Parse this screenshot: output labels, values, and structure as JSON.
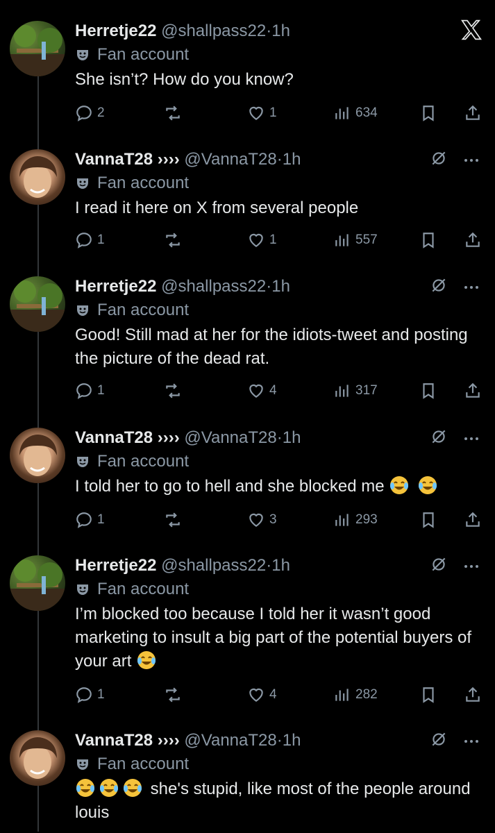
{
  "app": {
    "logo": "x-logo-icon"
  },
  "tweets": [
    {
      "name": "Herretje22",
      "handle": "@shallpass22",
      "dot": "·",
      "time": "1h",
      "label": "Fan account",
      "text": "She isn’t? How do you know?",
      "replies": "2",
      "likes": "1",
      "views": "634",
      "avatar": "green"
    },
    {
      "name": "VannaT28 ››››",
      "handle": "@VannaT28",
      "dot": "·",
      "time": "1h",
      "label": "Fan account",
      "text": "I read it here on X from several people",
      "replies": "1",
      "likes": "1",
      "views": "557",
      "avatar": "face"
    },
    {
      "name": "Herretje22",
      "handle": "@shallpass22",
      "dot": "·",
      "time": "1h",
      "label": "Fan account",
      "text": "Good! Still mad at her for the idiots-tweet and posting the picture of the dead rat.",
      "replies": "1",
      "likes": "4",
      "views": "317",
      "avatar": "green"
    },
    {
      "name": "VannaT28 ››››",
      "handle": "@VannaT28",
      "dot": "·",
      "time": "1h",
      "label": "Fan account",
      "text": "I told her to go to hell and she blocked me",
      "emoji_after": 2,
      "replies": "1",
      "likes": "3",
      "views": "293",
      "avatar": "face"
    },
    {
      "name": "Herretje22",
      "handle": "@shallpass22",
      "dot": "·",
      "time": "1h",
      "label": "Fan account",
      "text": "I’m blocked too because I told her it wasn’t good marketing to insult a big part of the potential buyers of your art",
      "emoji_after": 1,
      "replies": "1",
      "likes": "4",
      "views": "282",
      "avatar": "green"
    },
    {
      "name": "VannaT28 ››››",
      "handle": "@VannaT28",
      "dot": "·",
      "time": "1h",
      "label": "Fan account",
      "text": "she's stupid, like most of the people around louis",
      "emoji_before": 3,
      "avatar": "face"
    }
  ]
}
